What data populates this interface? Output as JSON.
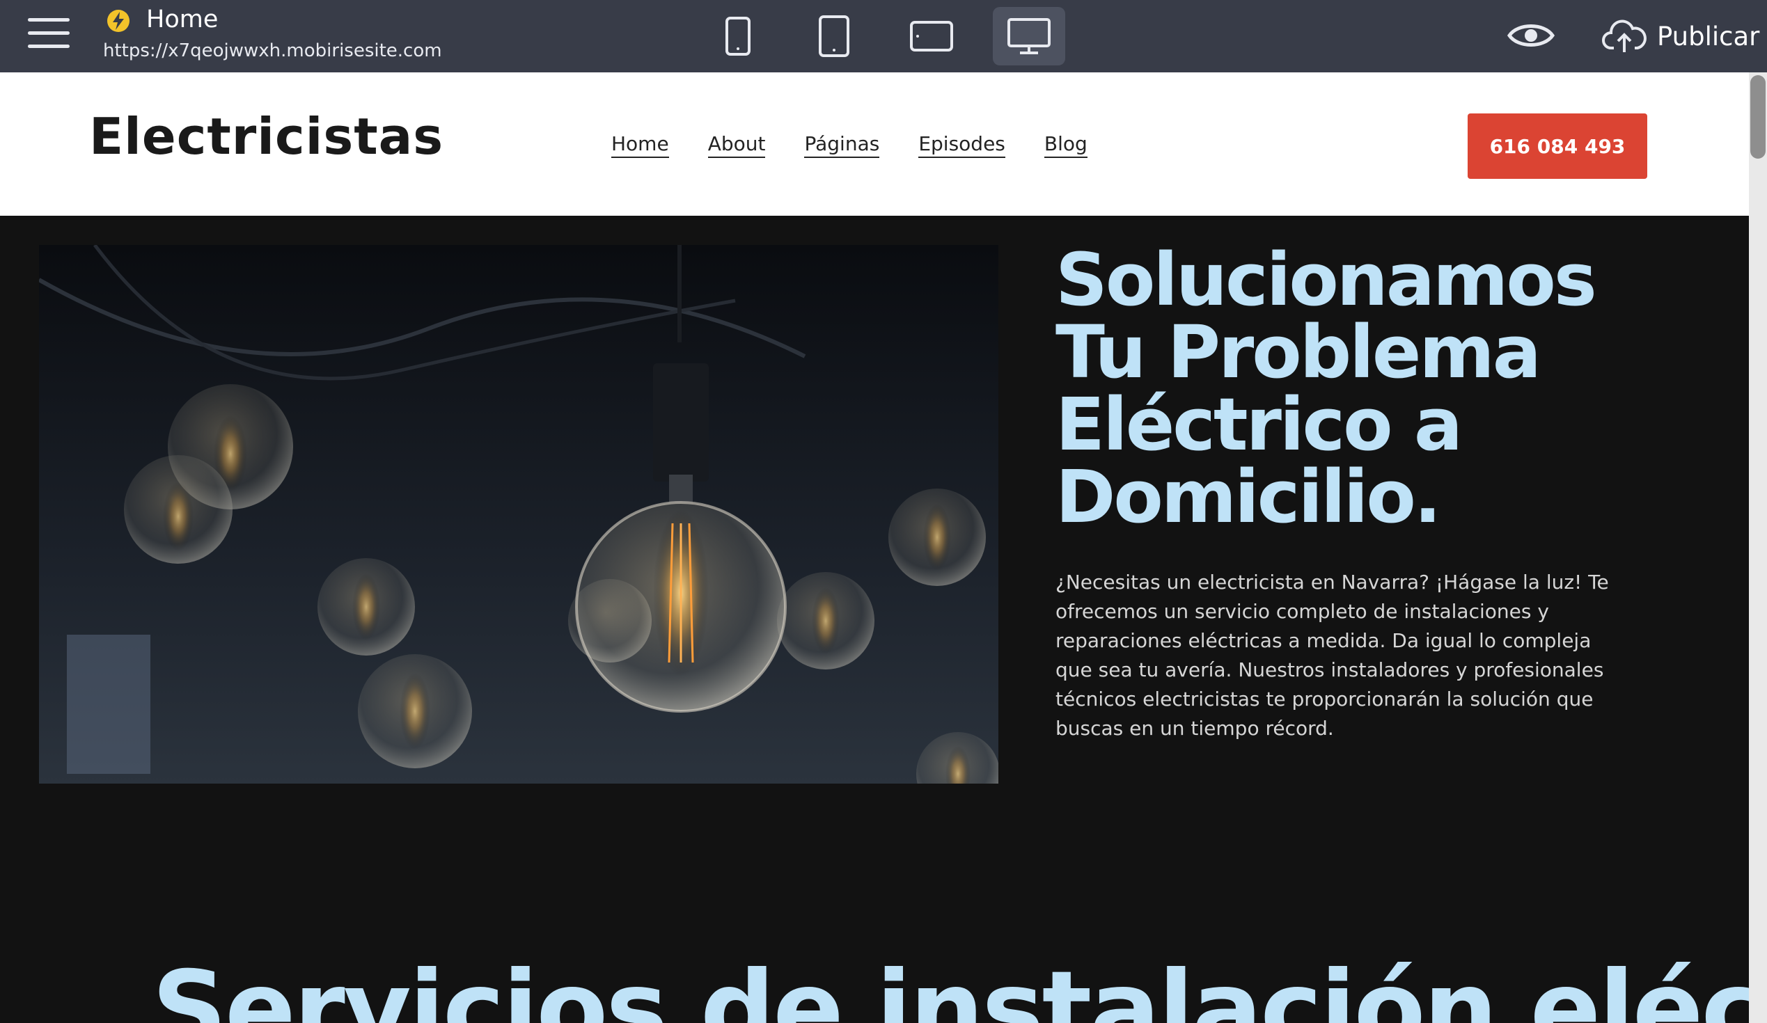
{
  "editor": {
    "page_title": "Home",
    "site_url": "https://x7qeojwwxh.mobirisesite.com",
    "publish_label": "Publicar",
    "devices": [
      "mobile-icon",
      "tablet-icon",
      "tablet-landscape-icon",
      "desktop-icon"
    ],
    "active_device": "desktop-icon"
  },
  "site": {
    "brand": "Electricistas",
    "nav": [
      "Home",
      "About",
      "Páginas",
      "Episodes",
      "Blog"
    ],
    "phone_button": "616 084 493",
    "hero": {
      "heading": "Solucionamos Tu Problema Eléctrico a Domicilio.",
      "text": "¿Necesitas un electricista en Navarra? ¡Hágase la luz! Te ofrecemos un servicio completo de instalaciones y reparaciones eléctricas a medida. Da igual lo compleja que sea tu avería. Nuestros instaladores y profesionales técnicos electricistas te proporcionarán la solución que buscas en un tiempo récord."
    },
    "next_section_heading": "Servicios de instalación eléctrica y"
  },
  "colors": {
    "editor_bar": "#383c48",
    "accent_button": "#db4433",
    "heading_light_blue": "#bfe2f7",
    "hero_background": "#121212"
  }
}
